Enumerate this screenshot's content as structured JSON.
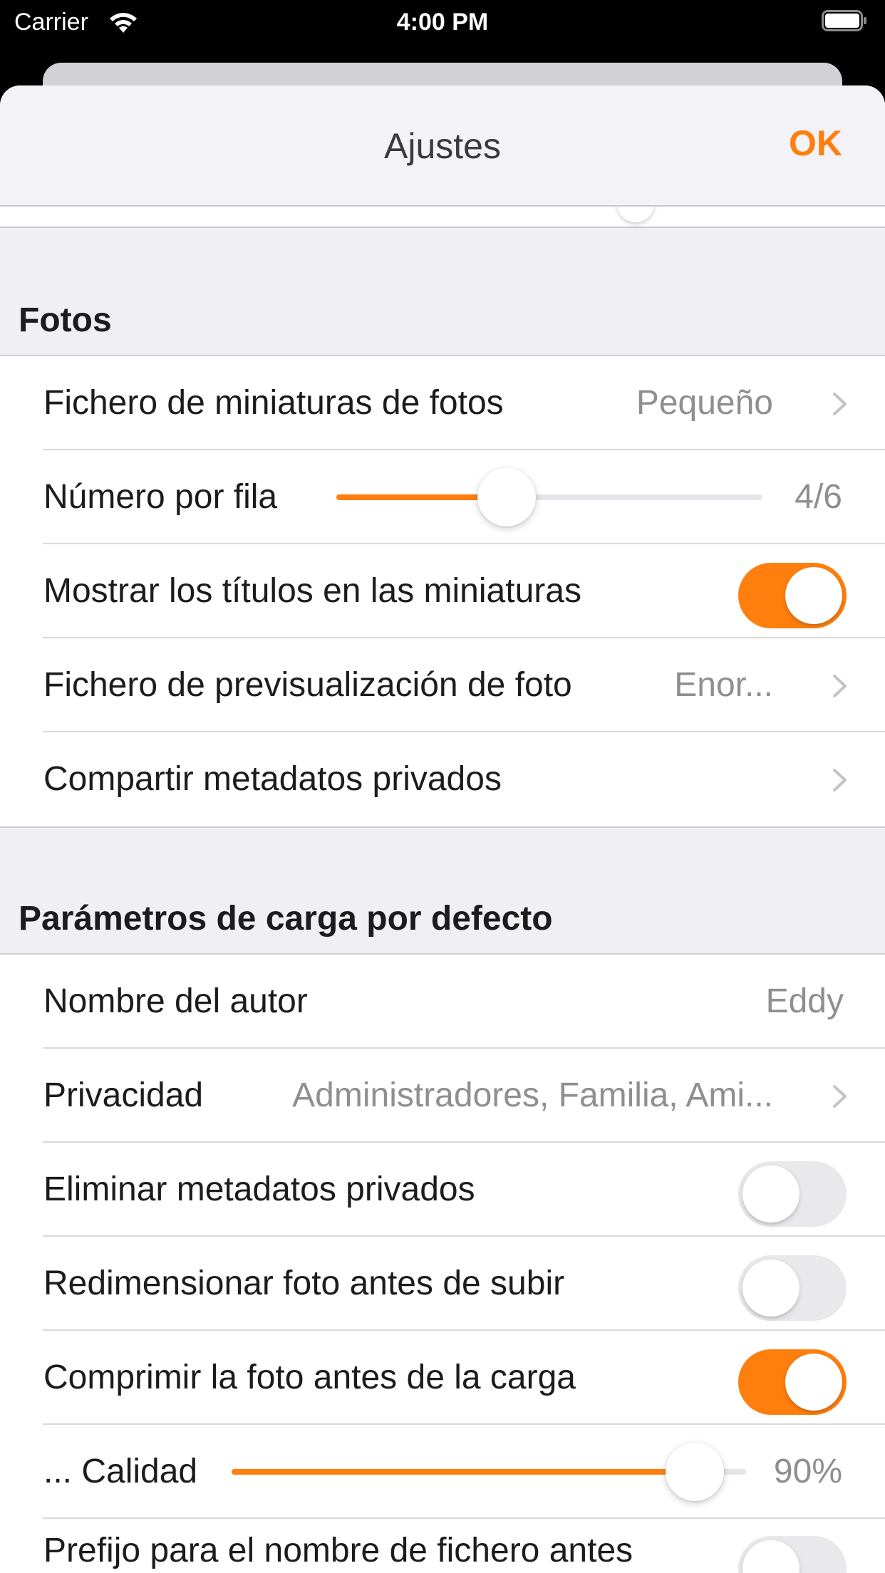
{
  "status_bar": {
    "carrier": "Carrier",
    "time": "4:00 PM",
    "wifi_icon": "wifi-icon",
    "battery_icon": "battery-icon"
  },
  "nav": {
    "title": "Ajustes",
    "ok_label": "OK"
  },
  "colors": {
    "accent": "#ff7f0e",
    "background": "#efeff4",
    "secondary_text": "#8e8e93"
  },
  "photos_section": {
    "header": "Fotos",
    "thumbnail_file": {
      "label": "Fichero de miniaturas de fotos",
      "value": "Pequeño"
    },
    "per_row": {
      "label": "Número por fila",
      "value_text": "4/6",
      "level": 0.4
    },
    "show_titles": {
      "label": "Mostrar los títulos en las miniaturas",
      "on": true
    },
    "preview_file": {
      "label": "Fichero de previsualización de foto",
      "value": "Enor..."
    },
    "share_private_metadata": {
      "label": "Compartir metadatos privados"
    }
  },
  "upload_section": {
    "header": "Parámetros de carga por defecto",
    "author": {
      "label": "Nombre del autor",
      "value": "Eddy"
    },
    "privacy": {
      "label": "Privacidad",
      "value": "Administradores, Familia, Ami..."
    },
    "strip_metadata": {
      "label": "Eliminar metadatos privados",
      "on": false
    },
    "resize": {
      "label": "Redimensionar foto antes de subir",
      "on": false
    },
    "compress": {
      "label": "Comprimir la foto antes de la carga",
      "on": true
    },
    "quality": {
      "label": "... Calidad",
      "value_text": "90%",
      "level": 0.9
    },
    "filename_prefix": {
      "label": "Prefijo para el nombre de fichero antes",
      "on": false
    }
  }
}
